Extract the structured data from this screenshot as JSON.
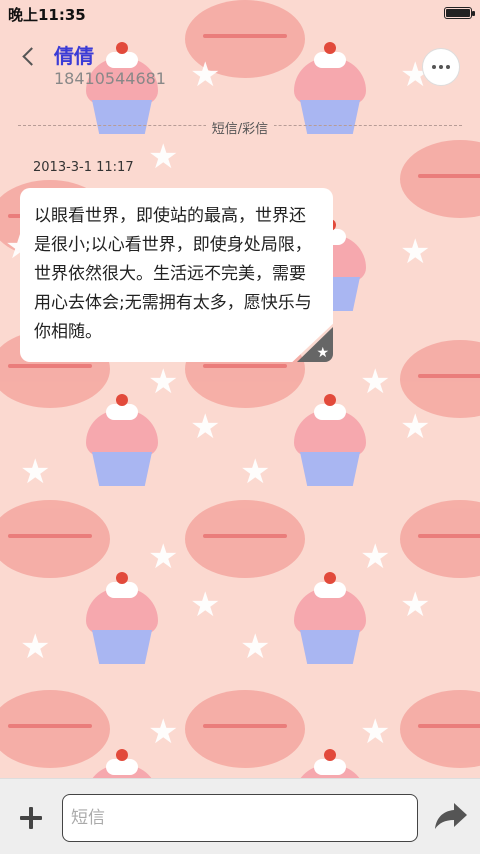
{
  "status_bar": {
    "time": "晚上11:35"
  },
  "header": {
    "contact_name": "倩倩",
    "contact_number": "18410544681"
  },
  "thread": {
    "channel_label": "短信/彩信",
    "messages": [
      {
        "timestamp": "2013-3-1 11:17",
        "text": "以眼看世界，即使站的最高，世界还是很小;以心看世界，即使身处局限，世界依然很大。生活远不完美，需要用心去体会;无需拥有太多，愿快乐与你相随。",
        "favorited": true
      }
    ]
  },
  "composer": {
    "placeholder": "短信",
    "value": ""
  },
  "icons": {
    "back": "chevron-left-icon",
    "more": "more-dots-icon",
    "add": "plus-icon",
    "send": "send-arrow-icon",
    "favorite": "star-icon"
  },
  "colors": {
    "contact_name": "#3b3bd6",
    "background": "#fbd9d0",
    "bottom_bar": "#eeeeee"
  }
}
